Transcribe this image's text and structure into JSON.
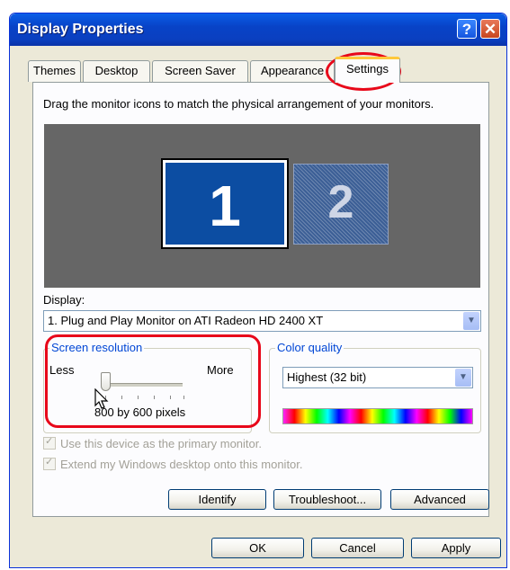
{
  "window": {
    "title": "Display Properties",
    "help_icon": "?",
    "close_icon": "✕"
  },
  "tabs": [
    {
      "label": "Themes"
    },
    {
      "label": "Desktop"
    },
    {
      "label": "Screen Saver"
    },
    {
      "label": "Appearance"
    },
    {
      "label": "Settings",
      "active": true
    }
  ],
  "settings": {
    "instruction": "Drag the monitor icons to match the physical arrangement of your monitors.",
    "monitors": [
      {
        "number": "1",
        "selected": true
      },
      {
        "number": "2",
        "selected": false
      }
    ],
    "display_label": "Display:",
    "display_value": "1. Plug and Play Monitor on ATI Radeon HD 2400 XT",
    "screen_resolution": {
      "title": "Screen resolution",
      "less_label": "Less",
      "more_label": "More",
      "value_text": "800 by 600 pixels",
      "slider_position": 0
    },
    "color_quality": {
      "title": "Color quality",
      "value": "Highest (32 bit)"
    },
    "primary_monitor_check": {
      "label": "Use this device as the primary monitor.",
      "checked": true,
      "enabled": false
    },
    "extend_desktop_check": {
      "label": "Extend my Windows desktop onto this monitor.",
      "checked": true,
      "enabled": false
    },
    "buttons": {
      "identify": "Identify",
      "troubleshoot": "Troubleshoot...",
      "advanced": "Advanced"
    }
  },
  "dialog_buttons": {
    "ok": "OK",
    "cancel": "Cancel",
    "apply": "Apply"
  },
  "colors": {
    "title_bar": "#0a4fd6",
    "active_tab_highlight": "#ffc83c",
    "group_title": "#0046d5",
    "annotation": "#e8081a",
    "monitor_primary": "#0c4da2"
  }
}
